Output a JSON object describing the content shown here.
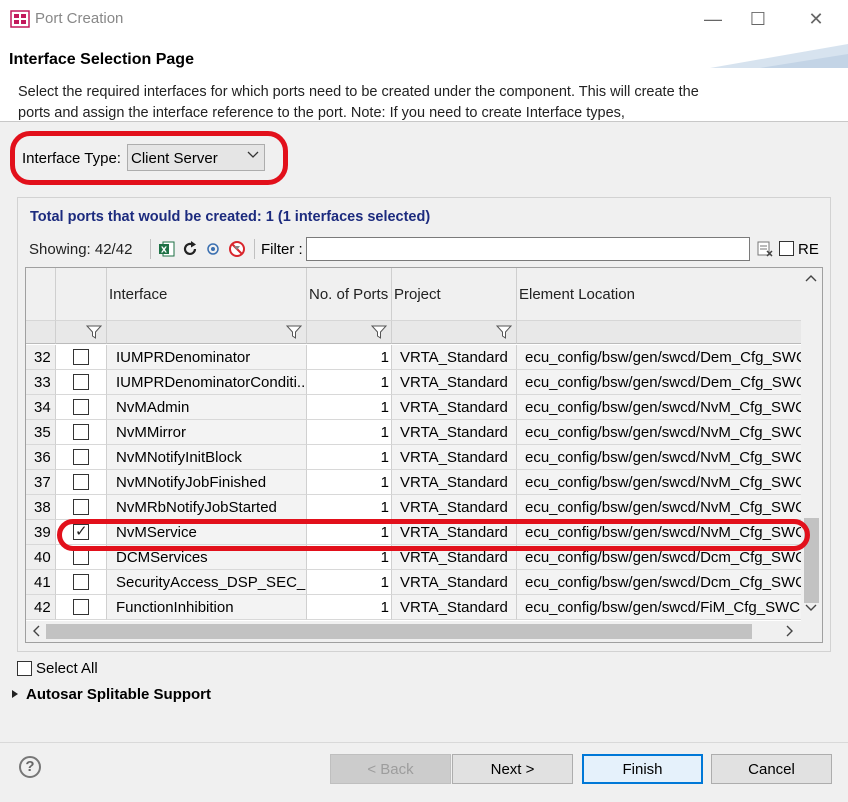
{
  "window": {
    "title": "Port Creation",
    "minimize_label": "—",
    "maximize_label": "☐",
    "close_label": "✕"
  },
  "header": {
    "title": "Interface Selection Page",
    "description": "Select the required interfaces for which ports need to be created under the component. This will create the ports and assign the interface reference to the port. Note: If you need to create Interface types,"
  },
  "interface_type": {
    "label": "Interface Type:",
    "selected": "Client Server"
  },
  "summary": {
    "total_ports": "Total ports that would be created: 1 (1 interfaces selected)",
    "showing": "Showing: 42/42"
  },
  "toolbar": {
    "filter_label": "Filter :",
    "filter_value": "",
    "re_label": "RE",
    "icons": [
      "excel-export-icon",
      "refresh-icon",
      "expand-icon",
      "clear-filter-icon",
      "filter-clear-icon"
    ]
  },
  "table": {
    "columns": [
      "",
      "",
      "Interface",
      "No. of Ports",
      "Project",
      "Element Location"
    ],
    "rows": [
      {
        "num": "32",
        "checked": false,
        "interface": "IUMPRDenominator",
        "ports": "1",
        "project": "VRTA_Standard",
        "location": "ecu_config/bsw/gen/swcd/Dem_Cfg_SWC"
      },
      {
        "num": "33",
        "checked": false,
        "interface": "IUMPRDenominatorConditi...",
        "ports": "1",
        "project": "VRTA_Standard",
        "location": "ecu_config/bsw/gen/swcd/Dem_Cfg_SWC"
      },
      {
        "num": "34",
        "checked": false,
        "interface": "NvMAdmin",
        "ports": "1",
        "project": "VRTA_Standard",
        "location": "ecu_config/bsw/gen/swcd/NvM_Cfg_SWC"
      },
      {
        "num": "35",
        "checked": false,
        "interface": "NvMMirror",
        "ports": "1",
        "project": "VRTA_Standard",
        "location": "ecu_config/bsw/gen/swcd/NvM_Cfg_SWC"
      },
      {
        "num": "36",
        "checked": false,
        "interface": "NvMNotifyInitBlock",
        "ports": "1",
        "project": "VRTA_Standard",
        "location": "ecu_config/bsw/gen/swcd/NvM_Cfg_SWC"
      },
      {
        "num": "37",
        "checked": false,
        "interface": "NvMNotifyJobFinished",
        "ports": "1",
        "project": "VRTA_Standard",
        "location": "ecu_config/bsw/gen/swcd/NvM_Cfg_SWC"
      },
      {
        "num": "38",
        "checked": false,
        "interface": "NvMRbNotifyJobStarted",
        "ports": "1",
        "project": "VRTA_Standard",
        "location": "ecu_config/bsw/gen/swcd/NvM_Cfg_SWC"
      },
      {
        "num": "39",
        "checked": true,
        "interface": "NvMService",
        "ports": "1",
        "project": "VRTA_Standard",
        "location": "ecu_config/bsw/gen/swcd/NvM_Cfg_SWC"
      },
      {
        "num": "40",
        "checked": false,
        "interface": "DCMServices",
        "ports": "1",
        "project": "VRTA_Standard",
        "location": "ecu_config/bsw/gen/swcd/Dcm_Cfg_SWC"
      },
      {
        "num": "41",
        "checked": false,
        "interface": "SecurityAccess_DSP_SEC_LE...",
        "ports": "1",
        "project": "VRTA_Standard",
        "location": "ecu_config/bsw/gen/swcd/Dcm_Cfg_SWC"
      },
      {
        "num": "42",
        "checked": false,
        "interface": "FunctionInhibition",
        "ports": "1",
        "project": "VRTA_Standard",
        "location": "ecu_config/bsw/gen/swcd/FiM_Cfg_SWCD"
      }
    ]
  },
  "options": {
    "select_all_label": "Select All",
    "select_all_checked": false,
    "autosar_splitable_label": "Autosar Splitable Support"
  },
  "buttons": {
    "help": "?",
    "back": "< Back",
    "next": "Next >",
    "finish": "Finish",
    "cancel": "Cancel"
  },
  "colors": {
    "highlight": "#e2101b",
    "summary_text": "#1c2b7e",
    "default_button_border": "#0078d7"
  }
}
